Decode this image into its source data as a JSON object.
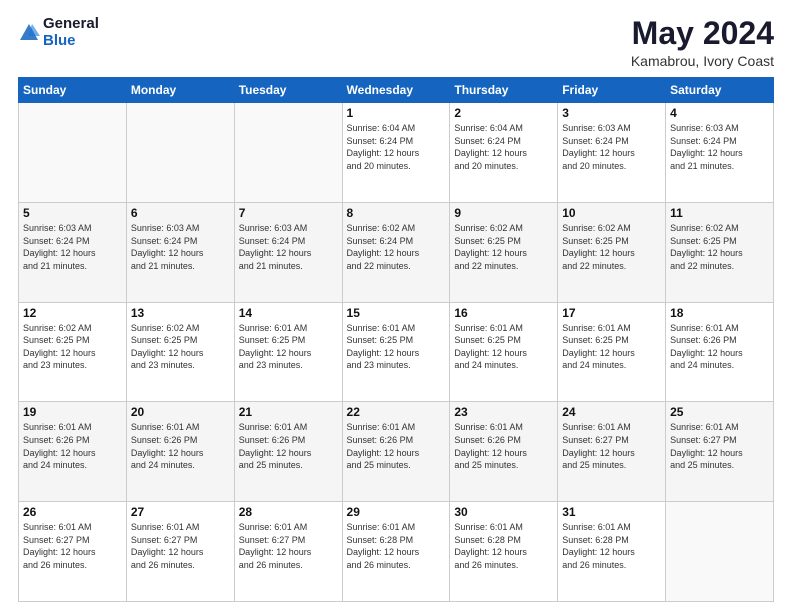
{
  "logo": {
    "general": "General",
    "blue": "Blue"
  },
  "title": "May 2024",
  "location": "Kamabrou, Ivory Coast",
  "days_of_week": [
    "Sunday",
    "Monday",
    "Tuesday",
    "Wednesday",
    "Thursday",
    "Friday",
    "Saturday"
  ],
  "weeks": [
    [
      {
        "day": "",
        "info": ""
      },
      {
        "day": "",
        "info": ""
      },
      {
        "day": "",
        "info": ""
      },
      {
        "day": "1",
        "info": "Sunrise: 6:04 AM\nSunset: 6:24 PM\nDaylight: 12 hours\nand 20 minutes."
      },
      {
        "day": "2",
        "info": "Sunrise: 6:04 AM\nSunset: 6:24 PM\nDaylight: 12 hours\nand 20 minutes."
      },
      {
        "day": "3",
        "info": "Sunrise: 6:03 AM\nSunset: 6:24 PM\nDaylight: 12 hours\nand 20 minutes."
      },
      {
        "day": "4",
        "info": "Sunrise: 6:03 AM\nSunset: 6:24 PM\nDaylight: 12 hours\nand 21 minutes."
      }
    ],
    [
      {
        "day": "5",
        "info": "Sunrise: 6:03 AM\nSunset: 6:24 PM\nDaylight: 12 hours\nand 21 minutes."
      },
      {
        "day": "6",
        "info": "Sunrise: 6:03 AM\nSunset: 6:24 PM\nDaylight: 12 hours\nand 21 minutes."
      },
      {
        "day": "7",
        "info": "Sunrise: 6:03 AM\nSunset: 6:24 PM\nDaylight: 12 hours\nand 21 minutes."
      },
      {
        "day": "8",
        "info": "Sunrise: 6:02 AM\nSunset: 6:24 PM\nDaylight: 12 hours\nand 22 minutes."
      },
      {
        "day": "9",
        "info": "Sunrise: 6:02 AM\nSunset: 6:25 PM\nDaylight: 12 hours\nand 22 minutes."
      },
      {
        "day": "10",
        "info": "Sunrise: 6:02 AM\nSunset: 6:25 PM\nDaylight: 12 hours\nand 22 minutes."
      },
      {
        "day": "11",
        "info": "Sunrise: 6:02 AM\nSunset: 6:25 PM\nDaylight: 12 hours\nand 22 minutes."
      }
    ],
    [
      {
        "day": "12",
        "info": "Sunrise: 6:02 AM\nSunset: 6:25 PM\nDaylight: 12 hours\nand 23 minutes."
      },
      {
        "day": "13",
        "info": "Sunrise: 6:02 AM\nSunset: 6:25 PM\nDaylight: 12 hours\nand 23 minutes."
      },
      {
        "day": "14",
        "info": "Sunrise: 6:01 AM\nSunset: 6:25 PM\nDaylight: 12 hours\nand 23 minutes."
      },
      {
        "day": "15",
        "info": "Sunrise: 6:01 AM\nSunset: 6:25 PM\nDaylight: 12 hours\nand 23 minutes."
      },
      {
        "day": "16",
        "info": "Sunrise: 6:01 AM\nSunset: 6:25 PM\nDaylight: 12 hours\nand 24 minutes."
      },
      {
        "day": "17",
        "info": "Sunrise: 6:01 AM\nSunset: 6:25 PM\nDaylight: 12 hours\nand 24 minutes."
      },
      {
        "day": "18",
        "info": "Sunrise: 6:01 AM\nSunset: 6:26 PM\nDaylight: 12 hours\nand 24 minutes."
      }
    ],
    [
      {
        "day": "19",
        "info": "Sunrise: 6:01 AM\nSunset: 6:26 PM\nDaylight: 12 hours\nand 24 minutes."
      },
      {
        "day": "20",
        "info": "Sunrise: 6:01 AM\nSunset: 6:26 PM\nDaylight: 12 hours\nand 24 minutes."
      },
      {
        "day": "21",
        "info": "Sunrise: 6:01 AM\nSunset: 6:26 PM\nDaylight: 12 hours\nand 25 minutes."
      },
      {
        "day": "22",
        "info": "Sunrise: 6:01 AM\nSunset: 6:26 PM\nDaylight: 12 hours\nand 25 minutes."
      },
      {
        "day": "23",
        "info": "Sunrise: 6:01 AM\nSunset: 6:26 PM\nDaylight: 12 hours\nand 25 minutes."
      },
      {
        "day": "24",
        "info": "Sunrise: 6:01 AM\nSunset: 6:27 PM\nDaylight: 12 hours\nand 25 minutes."
      },
      {
        "day": "25",
        "info": "Sunrise: 6:01 AM\nSunset: 6:27 PM\nDaylight: 12 hours\nand 25 minutes."
      }
    ],
    [
      {
        "day": "26",
        "info": "Sunrise: 6:01 AM\nSunset: 6:27 PM\nDaylight: 12 hours\nand 26 minutes."
      },
      {
        "day": "27",
        "info": "Sunrise: 6:01 AM\nSunset: 6:27 PM\nDaylight: 12 hours\nand 26 minutes."
      },
      {
        "day": "28",
        "info": "Sunrise: 6:01 AM\nSunset: 6:27 PM\nDaylight: 12 hours\nand 26 minutes."
      },
      {
        "day": "29",
        "info": "Sunrise: 6:01 AM\nSunset: 6:28 PM\nDaylight: 12 hours\nand 26 minutes."
      },
      {
        "day": "30",
        "info": "Sunrise: 6:01 AM\nSunset: 6:28 PM\nDaylight: 12 hours\nand 26 minutes."
      },
      {
        "day": "31",
        "info": "Sunrise: 6:01 AM\nSunset: 6:28 PM\nDaylight: 12 hours\nand 26 minutes."
      },
      {
        "day": "",
        "info": ""
      }
    ]
  ]
}
